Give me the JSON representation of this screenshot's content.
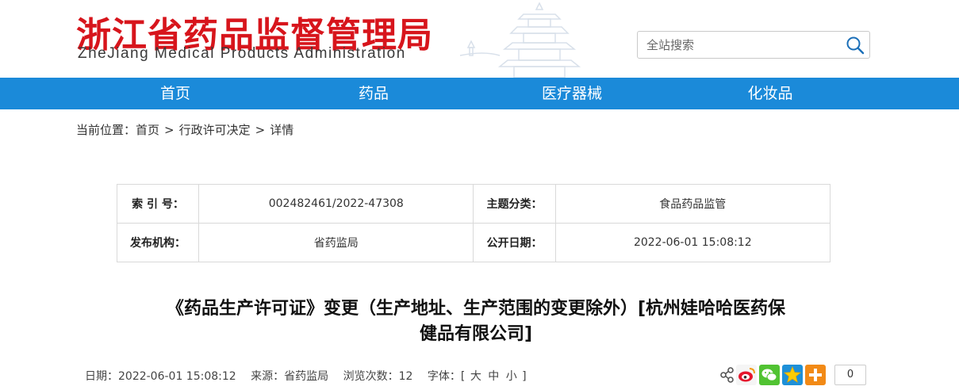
{
  "header": {
    "logo_cn": "浙江省药品监督管理局",
    "logo_en": "ZheJiang Medical Products Administration",
    "search_placeholder": "全站搜索"
  },
  "nav": {
    "items": [
      {
        "label": "首页"
      },
      {
        "label": "药品"
      },
      {
        "label": "医疗器械"
      },
      {
        "label": "化妆品"
      }
    ]
  },
  "breadcrumb": {
    "prefix": "当前位置：",
    "items": [
      "首页",
      "行政许可决定",
      "详情"
    ],
    "separator": ">"
  },
  "info": {
    "index_label": "索 引 号：",
    "index_value": "002482461/2022-47308",
    "topic_label": "主题分类：",
    "topic_value": "食品药品监管",
    "publisher_label": "发布机构：",
    "publisher_value": "省药监局",
    "date_label": "公开日期：",
    "date_value": "2022-06-01 15:08:12"
  },
  "article": {
    "title_line1": "《药品生产许可证》变更（生产地址、生产范围的变更除外）[杭州娃哈哈医药保",
    "title_line2": "健品有限公司]",
    "date": "日期：2022-06-01 15:08:12",
    "source": "来源：省药监局",
    "views": "浏览次数：12",
    "font_prefix": "字体：[",
    "font_large": "大",
    "font_medium": "中",
    "font_small": "小",
    "font_suffix": "]"
  },
  "share": {
    "count": "0",
    "icons": [
      "share-icon",
      "weibo-icon",
      "wechat-icon",
      "qzone-icon",
      "more-plus-icon"
    ]
  },
  "colors": {
    "brand_red": "#d7151c",
    "nav_blue": "#1b8ad9"
  }
}
